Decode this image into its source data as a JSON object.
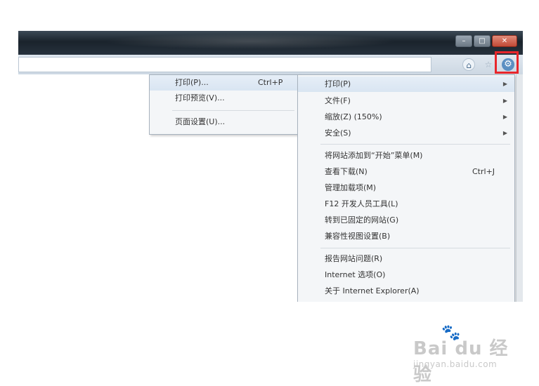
{
  "window": {
    "controls": {
      "minimize": "–",
      "maximize": "□",
      "close": "✕"
    }
  },
  "toolbar": {
    "address_value": "",
    "home_icon": "home-icon",
    "favorites_icon": "star-icon",
    "tools_icon": "gear-icon",
    "highlight_color": "#e8262b"
  },
  "print_submenu": {
    "items": [
      {
        "label": "打印(P)...",
        "shortcut": "Ctrl+P"
      },
      {
        "label": "打印预览(V)...",
        "shortcut": ""
      },
      {
        "label": "页面设置(U)...",
        "shortcut": ""
      }
    ]
  },
  "tools_menu": {
    "items": [
      {
        "label": "打印(P)",
        "shortcut": "",
        "submenu": true
      },
      {
        "label": "文件(F)",
        "shortcut": "",
        "submenu": true
      },
      {
        "label": "缩放(Z) (150%)",
        "shortcut": "",
        "submenu": true
      },
      {
        "label": "安全(S)",
        "shortcut": "",
        "submenu": true
      },
      {
        "label": "将网站添加到“开始”菜单(M)",
        "shortcut": "",
        "submenu": false
      },
      {
        "label": "查看下载(N)",
        "shortcut": "Ctrl+J",
        "submenu": false
      },
      {
        "label": "管理加载项(M)",
        "shortcut": "",
        "submenu": false
      },
      {
        "label": "F12 开发人员工具(L)",
        "shortcut": "",
        "submenu": false
      },
      {
        "label": "转到已固定的网站(G)",
        "shortcut": "",
        "submenu": false
      },
      {
        "label": "兼容性视图设置(B)",
        "shortcut": "",
        "submenu": false
      },
      {
        "label": "报告网站问题(R)",
        "shortcut": "",
        "submenu": false
      },
      {
        "label": "Internet 选项(O)",
        "shortcut": "",
        "submenu": false
      },
      {
        "label": "关于 Internet Explorer(A)",
        "shortcut": "",
        "submenu": false
      }
    ]
  },
  "watermark": {
    "logo": "Bai du 经验",
    "url": "jingyan.baidu.com"
  }
}
